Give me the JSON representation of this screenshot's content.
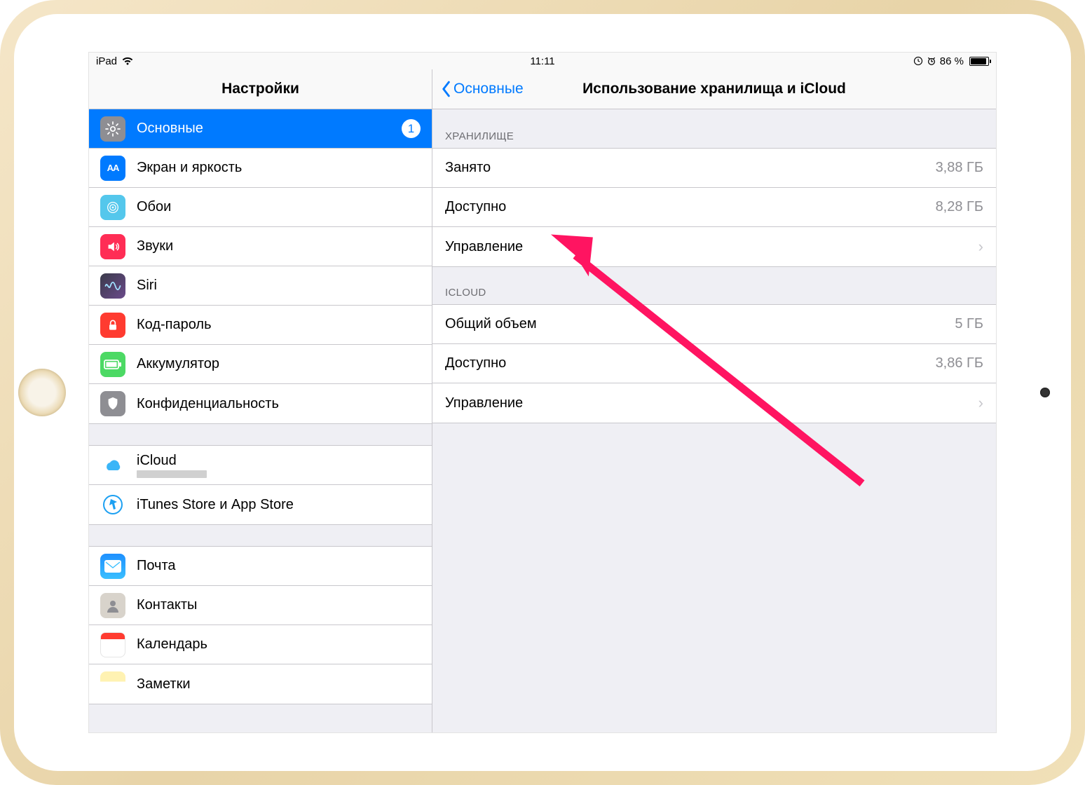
{
  "status": {
    "device": "iPad",
    "time": "11:11",
    "battery_pct": "86 %",
    "battery_fill": 86
  },
  "sidebar": {
    "title": "Настройки",
    "groups": [
      {
        "items": [
          {
            "icon": "general-icon",
            "label": "Основные",
            "selected": true,
            "badge": "1"
          },
          {
            "icon": "display-icon",
            "label": "Экран и яркость"
          },
          {
            "icon": "wallpaper-icon",
            "label": "Обои"
          },
          {
            "icon": "sounds-icon",
            "label": "Звуки"
          },
          {
            "icon": "siri-icon",
            "label": "Siri"
          },
          {
            "icon": "passcode-icon",
            "label": "Код-пароль"
          },
          {
            "icon": "battery-icon",
            "label": "Аккумулятор"
          },
          {
            "icon": "privacy-icon",
            "label": "Конфиденциальность"
          }
        ]
      },
      {
        "items": [
          {
            "icon": "icloud-icon",
            "label": "iCloud",
            "sub": true
          },
          {
            "icon": "itunes-icon",
            "label": "iTunes Store и App Store"
          }
        ]
      },
      {
        "items": [
          {
            "icon": "mail-icon",
            "label": "Почта"
          },
          {
            "icon": "contacts-icon",
            "label": "Контакты"
          },
          {
            "icon": "calendar-icon",
            "label": "Календарь"
          },
          {
            "icon": "notes-icon",
            "label": "Заметки"
          }
        ]
      }
    ]
  },
  "detail": {
    "back": "Основные",
    "title": "Использование хранилища и iCloud",
    "groups": [
      {
        "header": "Хранилище",
        "rows": [
          {
            "label": "Занято",
            "value": "3,88 ГБ"
          },
          {
            "label": "Доступно",
            "value": "8,28 ГБ"
          },
          {
            "label": "Управление",
            "disclosure": true,
            "interactable": true
          }
        ]
      },
      {
        "header": "iCloud",
        "rows": [
          {
            "label": "Общий объем",
            "value": "5 ГБ"
          },
          {
            "label": "Доступно",
            "value": "3,86 ГБ"
          },
          {
            "label": "Управление",
            "disclosure": true,
            "interactable": true
          }
        ]
      }
    ]
  }
}
